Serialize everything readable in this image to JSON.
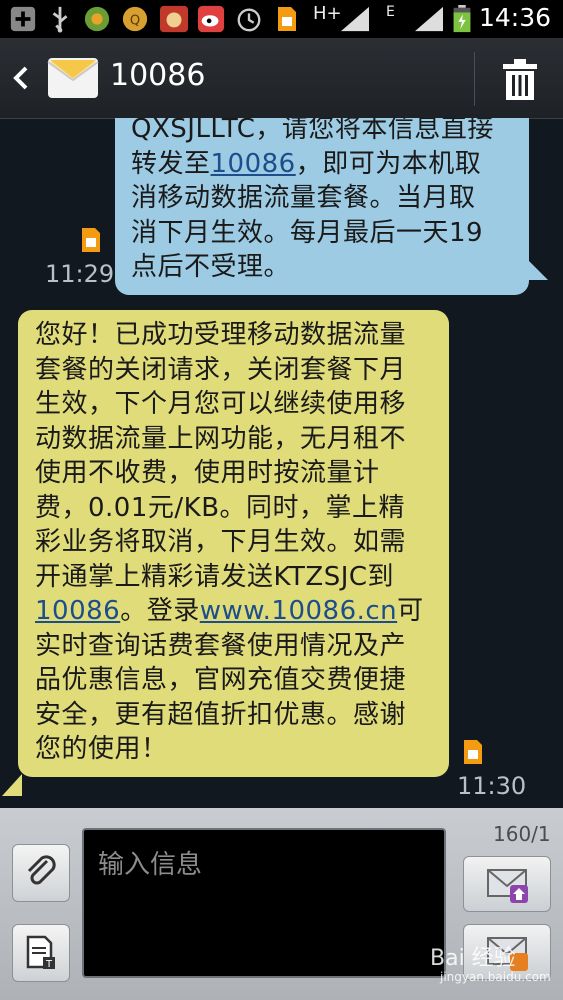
{
  "status_bar": {
    "time": "14:36",
    "network": "H+",
    "signal_label": "E",
    "icons": [
      "add-icon",
      "usb-icon",
      "app-icon",
      "app-icon",
      "cow-icon",
      "weibo-icon",
      "alarm-icon",
      "sim-icon",
      "signal-icon",
      "battery-icon"
    ]
  },
  "header": {
    "title": "10086",
    "back_icon": "back-icon",
    "avatar_icon": "envelope-icon",
    "delete_icon": "trash-icon"
  },
  "messages": [
    {
      "direction": "outgoing",
      "text_before": "QXSJLLTC，请您将本信息直接转发至",
      "link": "10086",
      "text_after": "，即可为本机取消移动数据流量套餐。当月取消下月生效。每月最后一天19点后不受理。",
      "time": "11:29",
      "color": "#9dcbe3"
    },
    {
      "direction": "incoming",
      "text_part1": "您好！已成功受理移动数据流量套餐的关闭请求，关闭套餐下月生效，下个月您可以继续使用移动数据流量上网功能，无月租不使用不收费，使用时按流量计费，0.01元/KB。同时，掌上精彩业务将取消，下月生效。如需开通掌上精彩请发送KTZSJC到",
      "link1": "10086",
      "text_part2": "。登录",
      "link2": "www.10086.cn",
      "text_part3": "可实时查询话费套餐使用情况及产品优惠信息，官网充值交费便捷安全，更有超值折扣优惠。感谢您的使用！",
      "time": "11:30",
      "color": "#e1dc7a"
    }
  ],
  "composer": {
    "placeholder": "输入信息",
    "counter": "160/1",
    "attach_icon": "paperclip-icon",
    "template_icon": "template-icon",
    "send_icon": "send-envelope-icon"
  },
  "watermark": {
    "brand": "Bai 经验",
    "url": "jingyan.baidu.com"
  }
}
